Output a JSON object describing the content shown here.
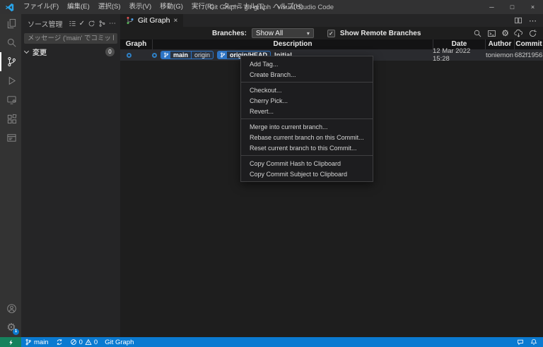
{
  "titlebar": {
    "title": "Git Graph - git-graph - Visual Studio Code",
    "menus": [
      "ファイル(F)",
      "編集(E)",
      "選択(S)",
      "表示(V)",
      "移動(G)",
      "実行(R)",
      "ターミナル(T)",
      "ヘルプ(H)"
    ]
  },
  "icons": {
    "minimize": "─",
    "maximize": "□",
    "close": "×",
    "more": "⋯",
    "check": "✓",
    "caret_down": "▾",
    "gear": "⚙"
  },
  "activity_bar": {
    "settings_badge": "1"
  },
  "sidebar": {
    "title": "ソース管理",
    "message_placeholder": "メッセージ ('main' でコミットするた...",
    "changes_label": "変更",
    "changes_badge": "0"
  },
  "editor": {
    "tab_label": "Git Graph"
  },
  "gitgraph": {
    "branches_label": "Branches:",
    "branches_value": "Show All",
    "show_remote_label": "Show Remote Branches",
    "columns": [
      "Graph",
      "Description",
      "Date",
      "Author",
      "Commit"
    ],
    "commit": {
      "ref_main": "main",
      "ref_origin": "origin",
      "ref_origin_head": "origin/HEAD",
      "message": "Initial",
      "date": "12 Mar 2022 15:28",
      "author": "toniemon",
      "hash": "682f1956"
    }
  },
  "context_menu": {
    "groups": [
      [
        "Add Tag...",
        "Create Branch..."
      ],
      [
        "Checkout...",
        "Cherry Pick...",
        "Revert..."
      ],
      [
        "Merge into current branch...",
        "Rebase current branch on this Commit...",
        "Reset current branch to this Commit..."
      ],
      [
        "Copy Commit Hash to Clipboard",
        "Copy Commit Subject to Clipboard"
      ]
    ]
  },
  "status_bar": {
    "branch": "main",
    "errors": "0",
    "warnings": "0",
    "extension_label": "Git Graph"
  },
  "colors": {
    "status_bar": "#0a7ad1",
    "remote_indicator": "#16825d",
    "ref_badge": "#2d74c4",
    "graph_node": "#2f81c6"
  }
}
